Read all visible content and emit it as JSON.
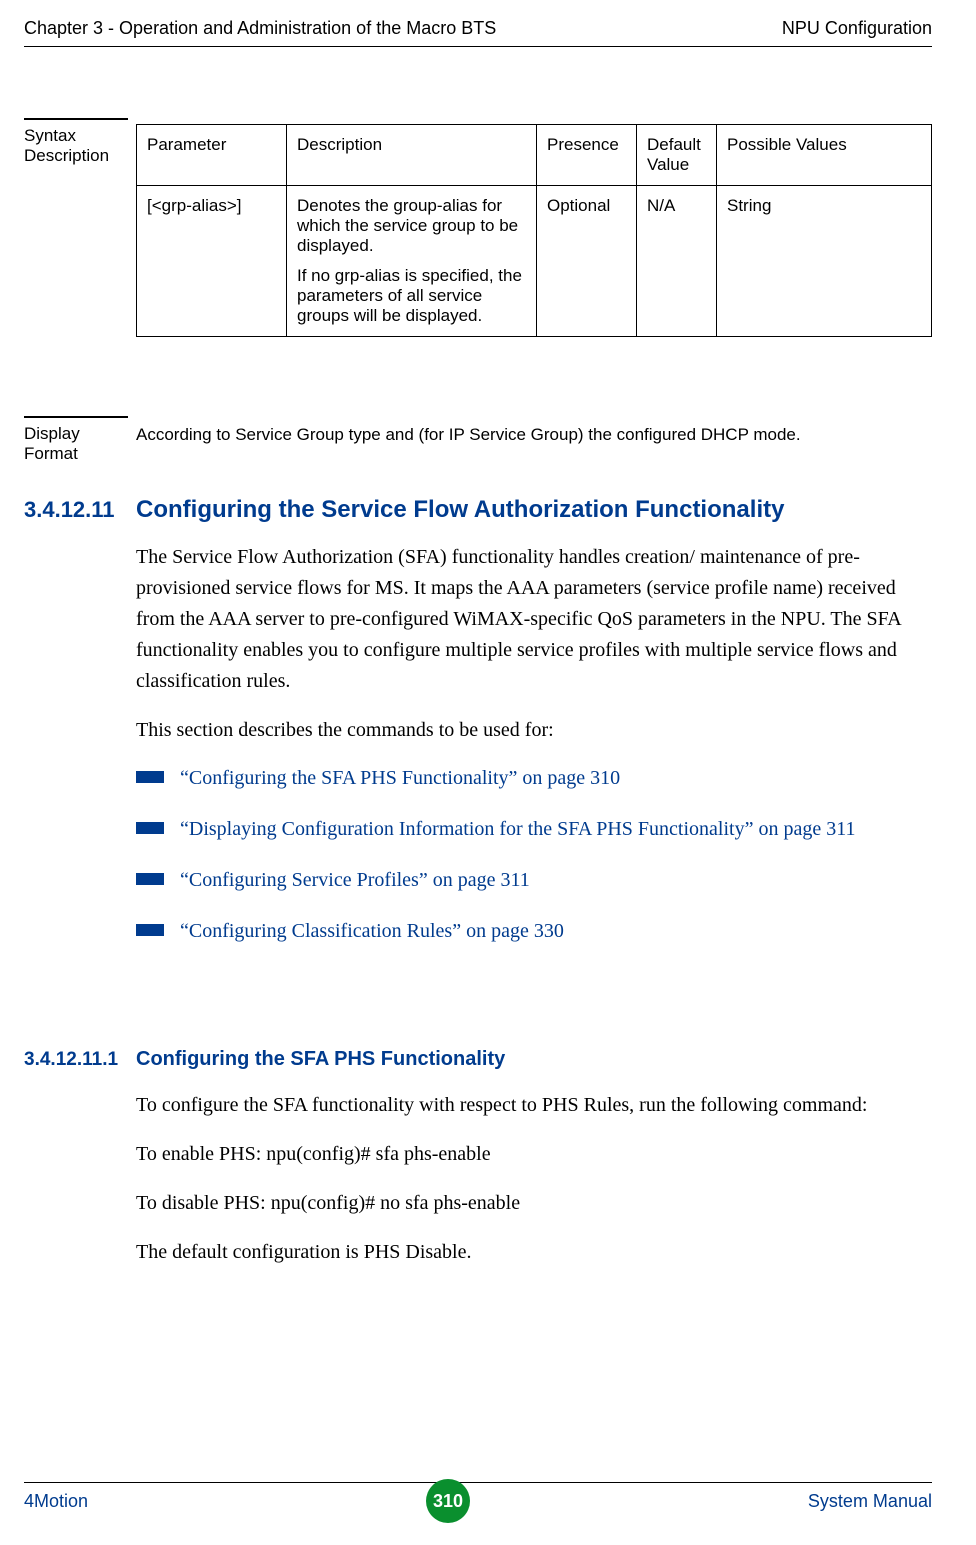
{
  "header": {
    "left": "Chapter 3 - Operation and Administration of the Macro BTS",
    "right": "NPU Configuration"
  },
  "syntaxDescription": {
    "label": "Syntax Description",
    "table": {
      "columns": {
        "parameter": "Parameter",
        "description": "Description",
        "presence": "Presence",
        "defaultValue": "Default Value",
        "possibleValues": "Possible Values"
      },
      "row": {
        "parameter": "[<grp-alias>]",
        "description1": "Denotes the group-alias for which the service group to be displayed.",
        "description2": "If no grp-alias is specified, the parameters of all service groups will be displayed.",
        "presence": "Optional",
        "defaultValue": "N/A",
        "possibleValues": "String"
      }
    }
  },
  "displayFormat": {
    "label": "Display Format",
    "text": "According to Service Group type and (for IP Service Group) the configured DHCP mode."
  },
  "section": {
    "num": "3.4.12.11",
    "title": "Configuring the Service Flow Authorization Functionality",
    "para1": "The Service Flow Authorization (SFA) functionality handles creation/ maintenance of pre-provisioned service flows for MS. It maps the AAA parameters (service profile name) received from the AAA server to pre-configured WiMAX-specific QoS parameters in the NPU. The SFA functionality enables you to configure multiple service profiles with multiple service flows and classification rules.",
    "para2": "This section describes the commands to be used for:",
    "links": {
      "l1": "“Configuring the SFA PHS Functionality” on page 310",
      "l2": "“Displaying Configuration Information for the SFA PHS Functionality” on page 311",
      "l3": "“Configuring Service Profiles” on page 311",
      "l4": "“Configuring Classification Rules” on page 330"
    }
  },
  "subsection": {
    "num": "3.4.12.11.1",
    "title": "Configuring the SFA PHS Functionality",
    "para1": "To configure the SFA functionality with respect to PHS Rules, run the following command:",
    "para2": "To enable PHS: npu(config)# sfa phs-enable",
    "para3": "To disable PHS: npu(config)# no sfa phs-enable",
    "para4": "The default configuration is PHS Disable."
  },
  "footer": {
    "left": "4Motion",
    "pageNum": "310",
    "right": "System Manual"
  }
}
